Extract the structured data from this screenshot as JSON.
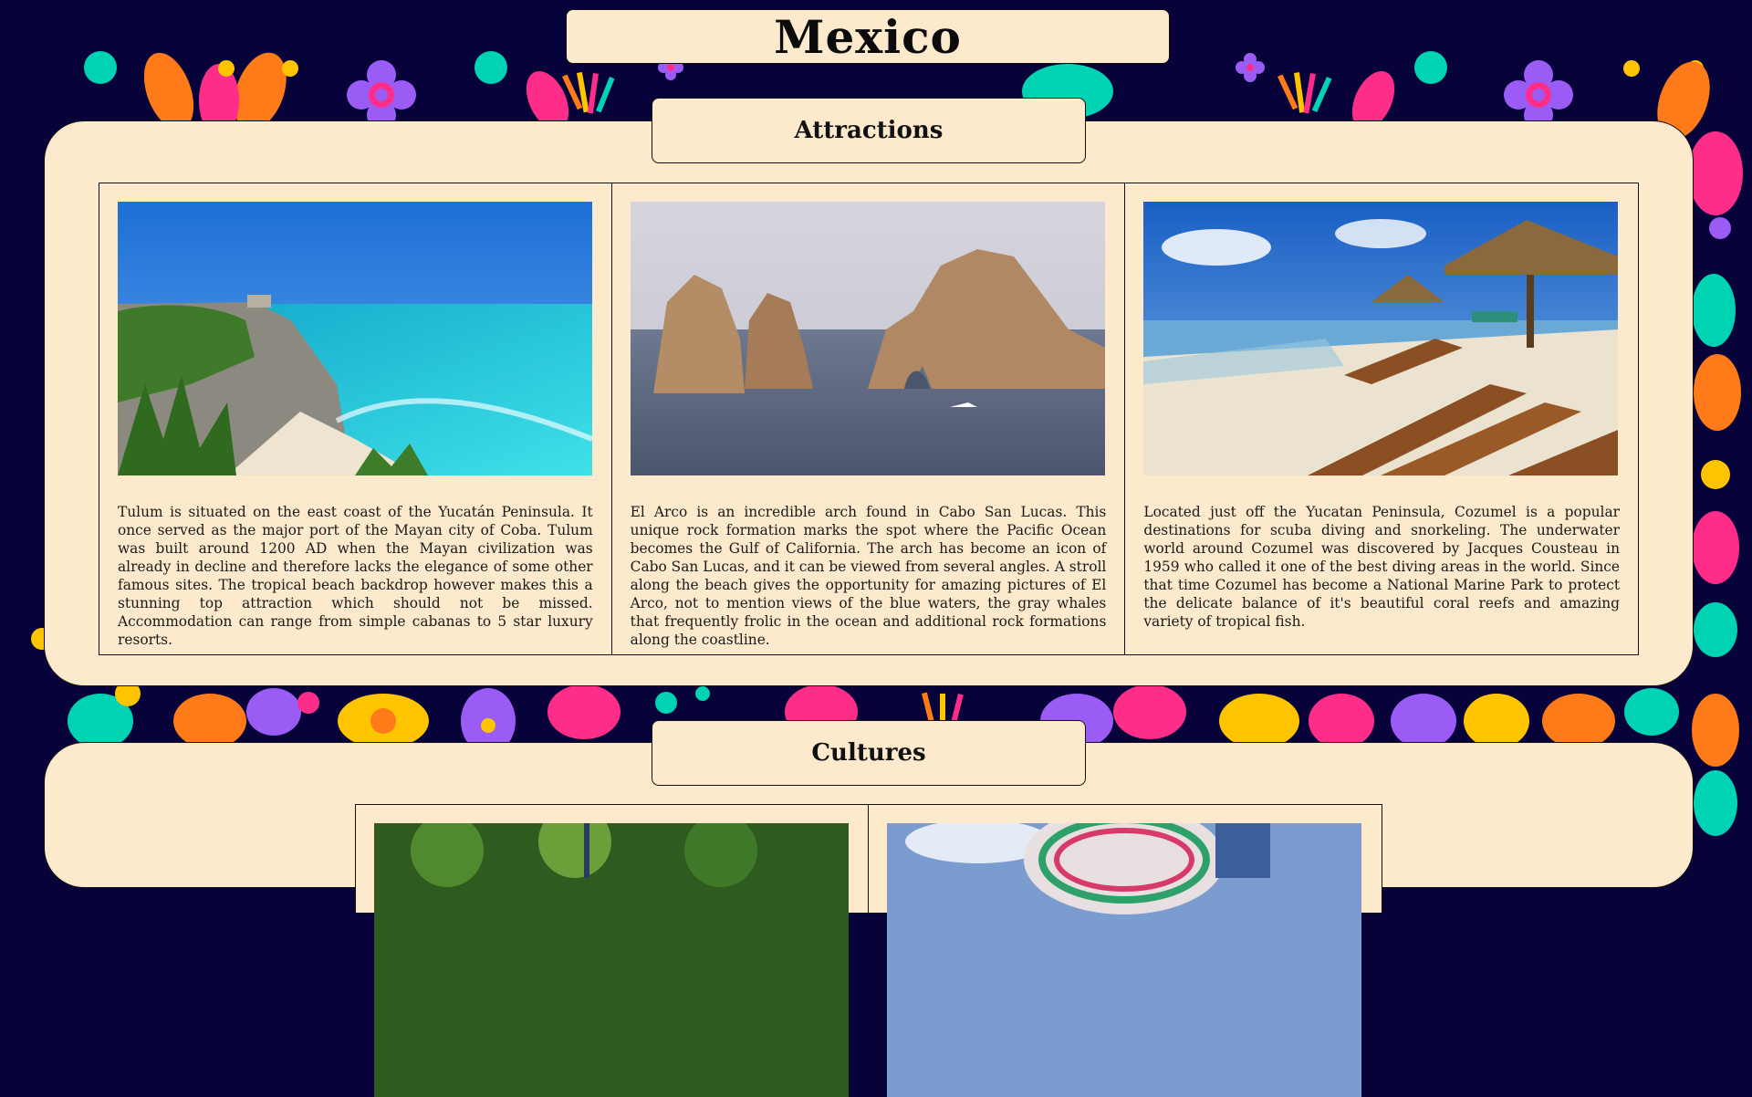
{
  "page": {
    "title": "Mexico"
  },
  "sections": {
    "attractions": {
      "title": "Attractions",
      "cards": [
        {
          "image": "tulum-beach-photo",
          "text": "Tulum is situated on the east coast of the Yucatán Peninsula. It once served as the major port of the Mayan city of Coba. Tulum was built around 1200 AD when the Mayan civilization was already in decline and therefore lacks the elegance of some other famous sites. The tropical beach backdrop however makes this a stunning top attraction which should not be missed. Accommodation can range from simple cabanas to 5 star luxury resorts."
        },
        {
          "image": "el-arco-photo",
          "text": "El Arco is an incredible arch found in Cabo San Lucas. This unique rock formation marks the spot where the Pacific Ocean becomes the Gulf of California. The arch has become an icon of Cabo San Lucas, and it can be viewed from several angles. A stroll along the beach gives the opportunity for amazing pictures of El Arco, not to mention views of the blue waters, the gray whales that frequently frolic in the ocean and additional rock formations along the coastline."
        },
        {
          "image": "cozumel-beach-photo",
          "text": "Located just off the Yucatan Peninsula, Cozumel is a popular destinations for scuba diving and snorkeling. The underwater world around Cozumel was discovered by Jacques Cousteau in 1959 who called it one of the best diving areas in the world. Since that time Cozumel has become a National Marine Park to protect the delicate balance of it's beautiful coral reefs and amazing variety of tropical fish."
        }
      ]
    },
    "cultures": {
      "title": "Cultures",
      "cards": [
        {
          "image": "jungle-culture-photo"
        },
        {
          "image": "feather-headdress-photo"
        }
      ]
    }
  },
  "colors": {
    "background": "#07033a",
    "panel": "#fde9cc",
    "accents": [
      "#ff7a18",
      "#ff2d8a",
      "#00d2b4",
      "#9b5cf6",
      "#ffc400"
    ]
  }
}
